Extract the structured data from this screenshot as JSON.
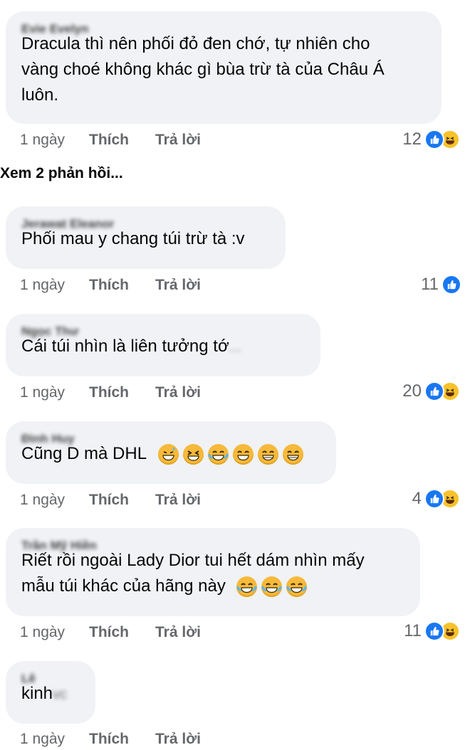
{
  "comments": [
    {
      "name": "Evie Evelyn",
      "lines": [
        "Dracula thì nên phối đỏ đen chớ, tự nhiên cho",
        "vàng choé không khác gì bùa trừ tà của Châu Á",
        "luôn."
      ],
      "time": "1 ngày",
      "like": "Thích",
      "reply": "Trả lời",
      "count": "12"
    },
    {
      "name": "Jerawat Eleanor",
      "lines": [
        "Phối mau y chang túi trừ tà :v"
      ],
      "time": "1 ngày",
      "like": "Thích",
      "reply": "Trả lời",
      "count": "11"
    },
    {
      "name": "Ngọc Thư",
      "lines": [
        "Cái túi nhìn là liên tưởng tớ"
      ],
      "tail": "...",
      "time": "1 ngày",
      "like": "Thích",
      "reply": "Trả lời",
      "count": "20"
    },
    {
      "name": "Đình Huy",
      "lines": [
        "Cũng D mà DHL"
      ],
      "time": "1 ngày",
      "like": "Thích",
      "reply": "Trả lời",
      "count": "4"
    },
    {
      "name": "Trần Mỹ Hiền",
      "lines": [
        "Riết rồi ngoài Lady Dior tui hết dám nhìn mấy",
        "mẫu túi khác của hãng này"
      ],
      "time": "1 ngày",
      "like": "Thích",
      "reply": "Trả lời",
      "count": "11"
    },
    {
      "name": "Lê",
      "lines": [
        "kinh"
      ],
      "tail": "vc",
      "time": "1 ngày",
      "like": "Thích",
      "reply": "Trả lời"
    }
  ],
  "view_replies": "Xem 2 phản hồi...",
  "colors": {
    "bubble": "#f0f2f5",
    "meta": "#65676b",
    "like": "#1877f2",
    "haha": "#f7c22b"
  },
  "icons": [
    "like-reaction-icon",
    "haha-reaction-icon",
    "sweat-smile-emoji",
    "laughing-emoji",
    "joy-emoji",
    "grin-emoji"
  ]
}
